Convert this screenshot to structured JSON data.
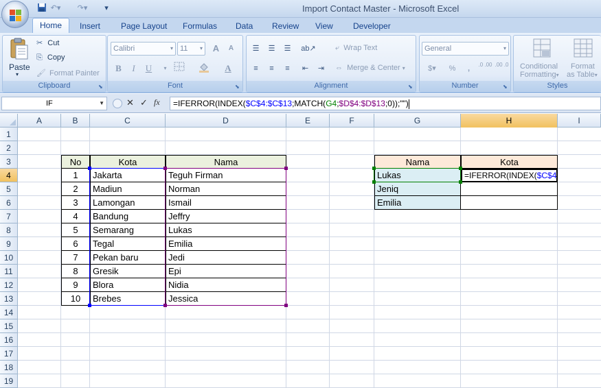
{
  "window": {
    "title": "Import Contact Master - Microsoft Excel"
  },
  "quick_access": {
    "save_icon": "save-icon",
    "undo_icon": "undo-icon",
    "redo_icon": "redo-icon",
    "customize_icon": "customize-icon"
  },
  "tabs": [
    "Home",
    "Insert",
    "Page Layout",
    "Formulas",
    "Data",
    "Review",
    "View",
    "Developer"
  ],
  "ribbon": {
    "clipboard": {
      "label": "Clipboard",
      "paste": "Paste",
      "cut": "Cut",
      "copy": "Copy",
      "format_painter": "Format Painter"
    },
    "font": {
      "label": "Font",
      "font_name": "Calibri",
      "font_size": "11",
      "bold": "B",
      "italic": "I",
      "underline": "U",
      "grow": "A",
      "shrink": "A",
      "font_color": "A"
    },
    "alignment": {
      "label": "Alignment",
      "wrap_text": "Wrap Text",
      "merge_center": "Merge & Center"
    },
    "number": {
      "label": "Number",
      "format": "General",
      "percent": "%",
      "comma": ",",
      "inc_decimal": ".0 .00",
      "dec_decimal": ".00 .0"
    },
    "styles": {
      "label": "Styles",
      "conditional_formatting_1": "Conditional",
      "conditional_formatting_2": "Formatting",
      "format_table_1": "Format",
      "format_table_2": "as Table"
    }
  },
  "formula_bar": {
    "name_box": "IF",
    "cancel": "✕",
    "enter": "✓",
    "fx": "fx",
    "formula_parts": [
      {
        "text": "=IFERROR(INDEX(",
        "color": "#000000"
      },
      {
        "text": "$C$4:$C$13",
        "color": "#0000ff"
      },
      {
        "text": ";MATCH(",
        "color": "#000000"
      },
      {
        "text": "G4",
        "color": "#008000"
      },
      {
        "text": ";",
        "color": "#000000"
      },
      {
        "text": "$D$4:$D$13",
        "color": "#800080"
      },
      {
        "text": ";0));\"\")",
        "color": "#000000"
      }
    ]
  },
  "columns": [
    "A",
    "B",
    "C",
    "D",
    "E",
    "F",
    "G",
    "H",
    "I"
  ],
  "rows": [
    "1",
    "2",
    "3",
    "4",
    "5",
    "6",
    "7",
    "8",
    "9",
    "10",
    "11",
    "12",
    "13",
    "14",
    "15",
    "16",
    "17",
    "18",
    "19"
  ],
  "selected_column": "H",
  "selected_row": "4",
  "table1": {
    "headers": [
      "No",
      "Kota",
      "Nama"
    ],
    "rows": [
      [
        "1",
        "Jakarta",
        "Teguh Firman"
      ],
      [
        "2",
        "Madiun",
        "Norman"
      ],
      [
        "3",
        "Lamongan",
        "Ismail"
      ],
      [
        "4",
        "Bandung",
        "Jeffry"
      ],
      [
        "5",
        "Semarang",
        "Lukas"
      ],
      [
        "6",
        "Tegal",
        "Emilia"
      ],
      [
        "7",
        "Pekan baru",
        "Jedi"
      ],
      [
        "8",
        "Gresik",
        "Epi"
      ],
      [
        "9",
        "Blora",
        "Nidia"
      ],
      [
        "10",
        "Brebes",
        "Jessica"
      ]
    ]
  },
  "table2": {
    "headers": [
      "Nama",
      "Kota"
    ],
    "names": [
      "Lukas",
      "Jeniq",
      "Emilia"
    ],
    "editing_cell": "=IFERROR(INDEX($C$4:"
  },
  "editing_parts": [
    {
      "text": "=IFERROR(INDEX(",
      "color": "#000000"
    },
    {
      "text": "$C$4:",
      "color": "#0000ff"
    }
  ]
}
